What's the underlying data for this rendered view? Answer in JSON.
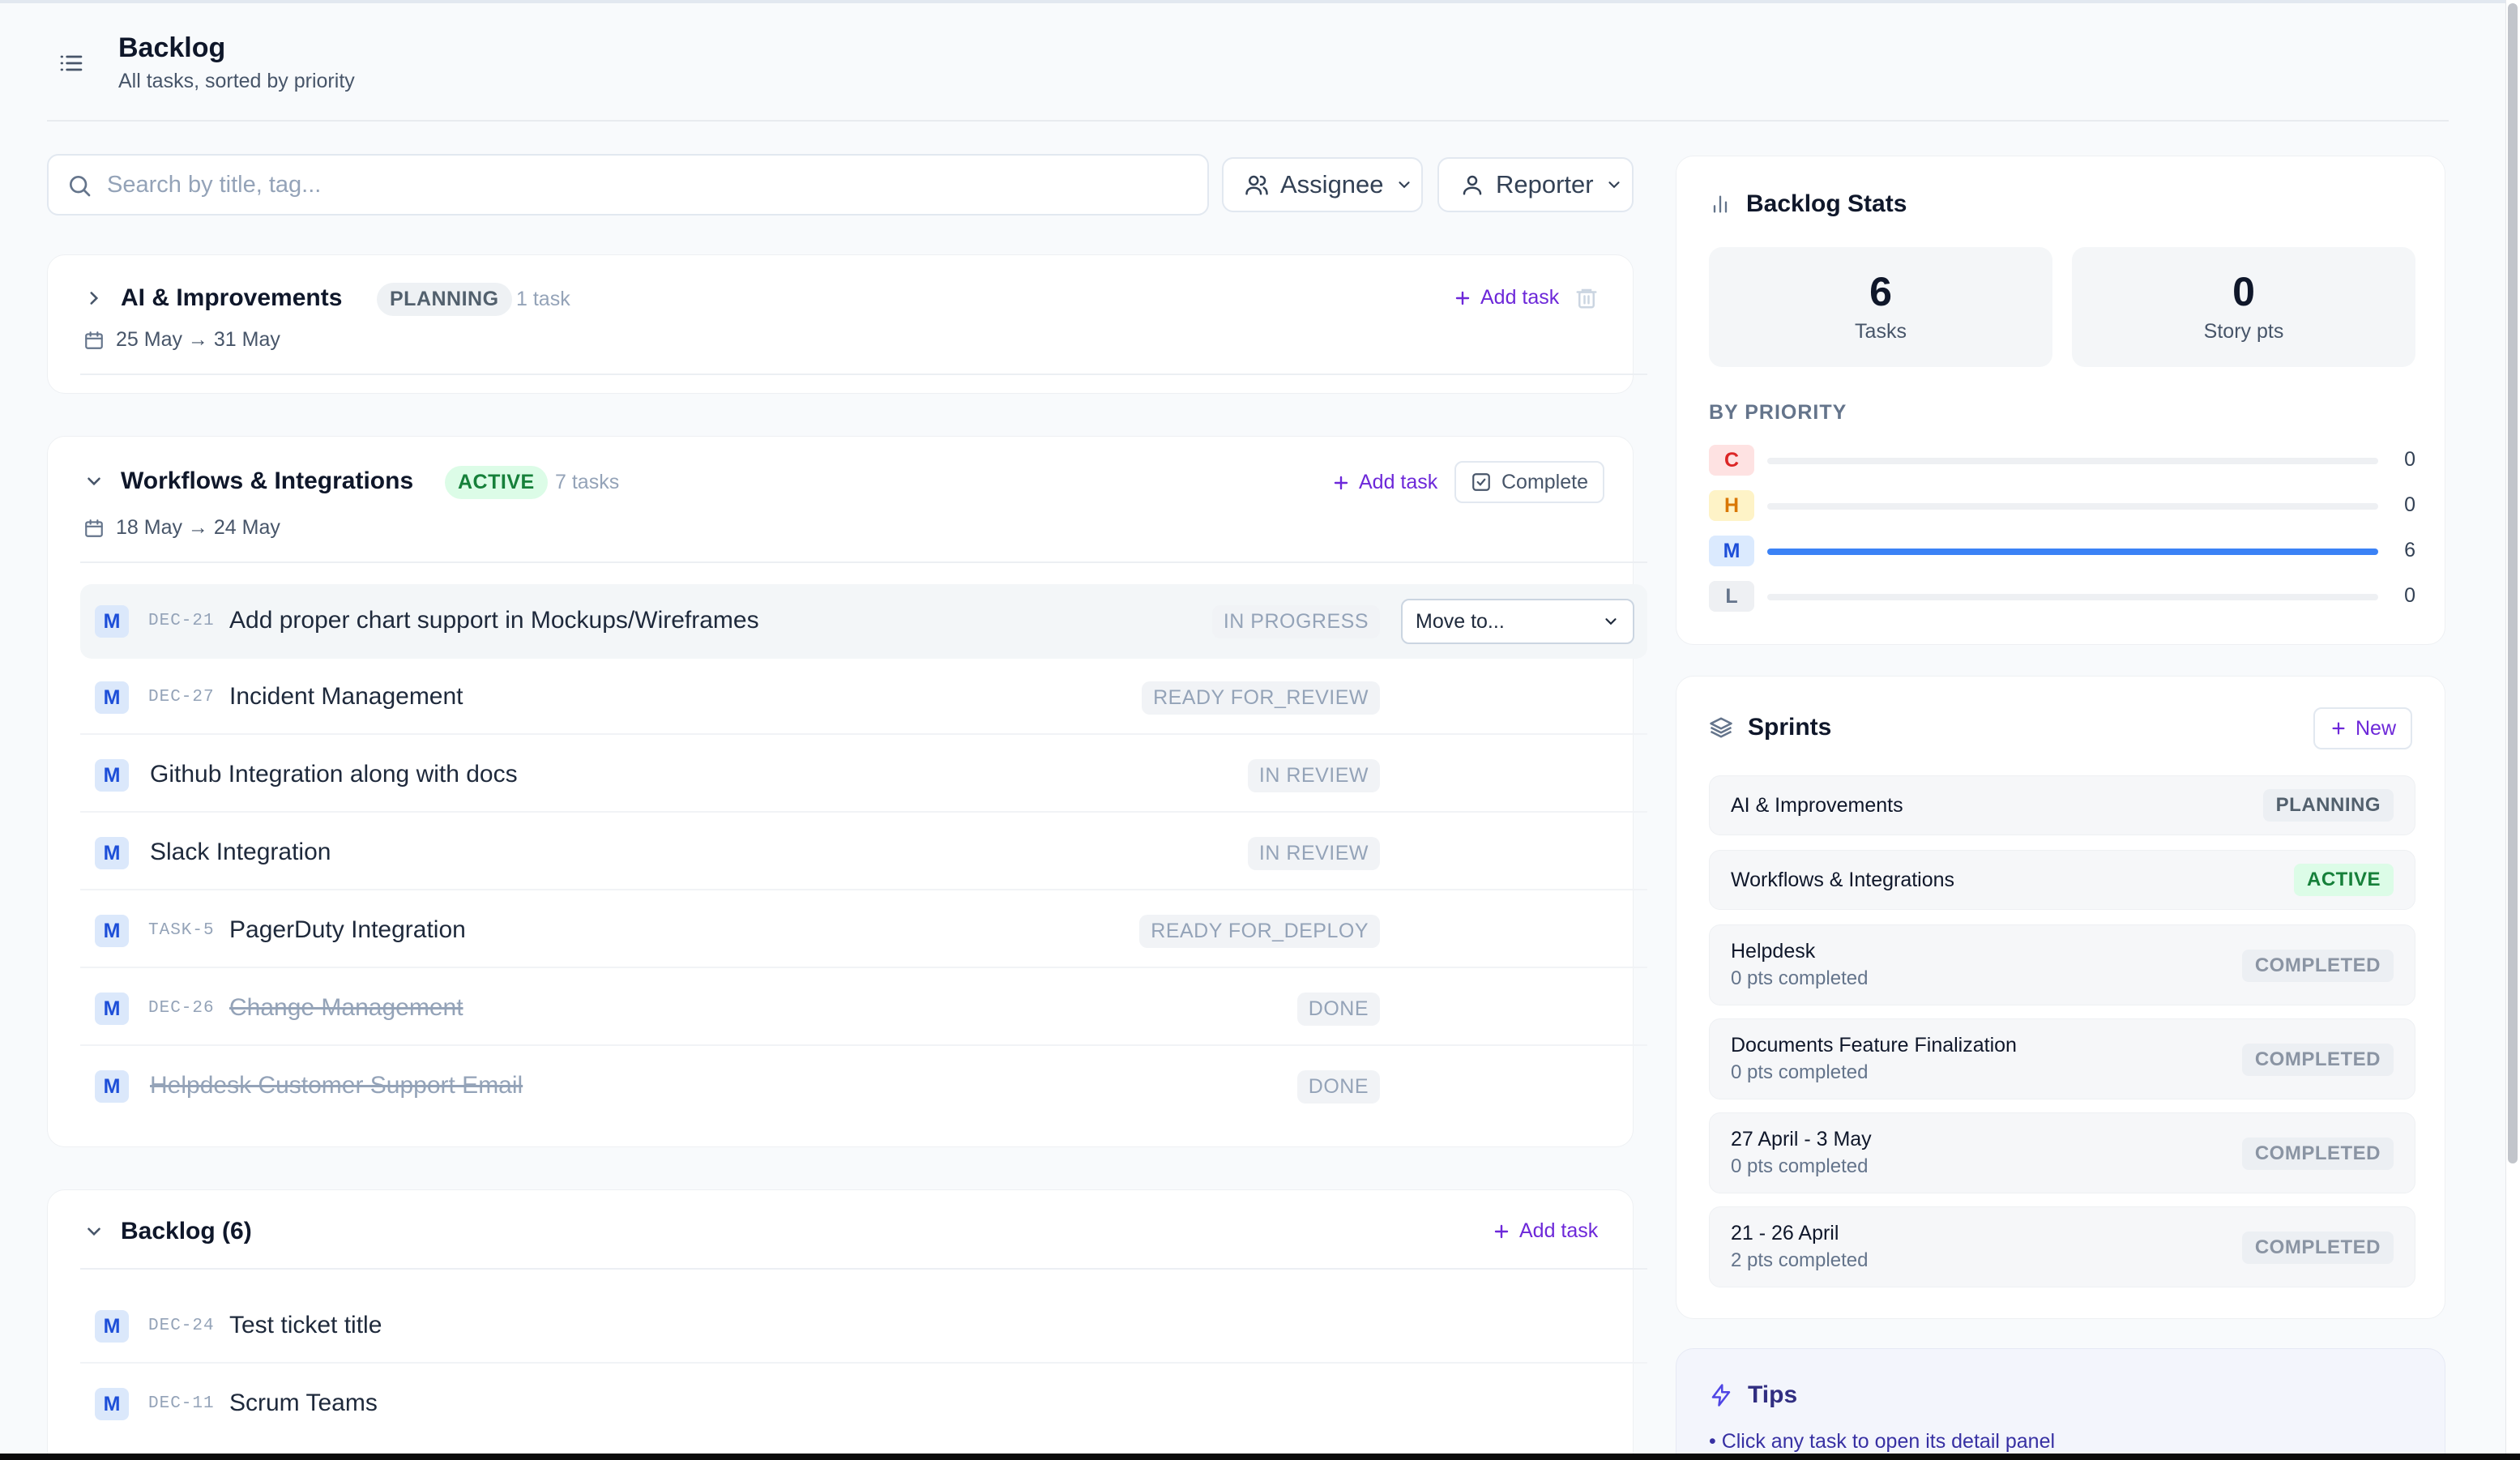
{
  "header": {
    "title": "Backlog",
    "subtitle": "All tasks, sorted by priority"
  },
  "search": {
    "placeholder": "Search by title, tag..."
  },
  "filters": {
    "assignee": "Assignee",
    "reporter": "Reporter"
  },
  "sprints_main": [
    {
      "name": "AI & Improvements",
      "status": "PLANNING",
      "task_count": "1 task",
      "dates": "25 May → 31 May",
      "add_task": "Add task",
      "expanded": false
    },
    {
      "name": "Workflows & Integrations",
      "status": "ACTIVE",
      "task_count": "7 tasks",
      "dates": "18 May → 24 May",
      "add_task": "Add task",
      "complete": "Complete",
      "expanded": true,
      "tasks": [
        {
          "priority": "M",
          "key": "DEC-21",
          "title": "Add proper chart support in Mockups/Wireframes",
          "status": "IN PROGRESS",
          "move_to": "Move to..."
        },
        {
          "priority": "M",
          "key": "DEC-27",
          "title": "Incident Management",
          "status": "READY FOR_REVIEW"
        },
        {
          "priority": "M",
          "key": "",
          "title": "Github Integration along with docs",
          "status": "IN REVIEW"
        },
        {
          "priority": "M",
          "key": "",
          "title": "Slack Integration",
          "status": "IN REVIEW"
        },
        {
          "priority": "M",
          "key": "TASK-5",
          "title": "PagerDuty Integration",
          "status": "READY FOR_DEPLOY"
        },
        {
          "priority": "M",
          "key": "DEC-26",
          "title": "Change Management",
          "status": "DONE"
        },
        {
          "priority": "M",
          "key": "",
          "title": "Helpdesk Customer Support Email",
          "status": "DONE"
        }
      ]
    }
  ],
  "backlog": {
    "title": "Backlog (6)",
    "add_task": "Add task",
    "tasks": [
      {
        "priority": "M",
        "key": "DEC-24",
        "title": "Test ticket title"
      },
      {
        "priority": "M",
        "key": "DEC-11",
        "title": "Scrum Teams"
      }
    ]
  },
  "stats": {
    "title": "Backlog Stats",
    "tasks_value": "6",
    "tasks_label": "Tasks",
    "points_value": "0",
    "points_label": "Story pts",
    "by_priority_label": "BY PRIORITY",
    "priorities": [
      {
        "label": "C",
        "count": 0,
        "count_text": "0",
        "fraction": 0,
        "chip_bg": "#fee2e2",
        "chip_fg": "#dc2626"
      },
      {
        "label": "H",
        "count": 0,
        "count_text": "0",
        "fraction": 0,
        "chip_bg": "#fef3c7",
        "chip_fg": "#d97706"
      },
      {
        "label": "M",
        "count": 6,
        "count_text": "6",
        "fraction": 1,
        "chip_bg": "#dbeafe",
        "chip_fg": "#1d4ed8"
      },
      {
        "label": "L",
        "count": 0,
        "count_text": "0",
        "fraction": 0,
        "chip_bg": "#eef0f3",
        "chip_fg": "#64748b"
      }
    ]
  },
  "sprints_panel": {
    "title": "Sprints",
    "new_label": "New",
    "items": [
      {
        "name": "AI & Improvements",
        "points": "",
        "status": "PLANNING"
      },
      {
        "name": "Workflows & Integrations",
        "points": "",
        "status": "ACTIVE"
      },
      {
        "name": "Helpdesk",
        "points": "0 pts completed",
        "status": "COMPLETED"
      },
      {
        "name": "Documents Feature Finalization",
        "points": "0 pts completed",
        "status": "COMPLETED"
      },
      {
        "name": "27 April - 3 May",
        "points": "0 pts completed",
        "status": "COMPLETED"
      },
      {
        "name": "21 - 26 April",
        "points": "2 pts completed",
        "status": "COMPLETED"
      }
    ]
  },
  "tips": {
    "title": "Tips",
    "line": "• Click any task to open its detail panel"
  },
  "colors": {
    "accent": "#6d28d9",
    "progress": "#3b82f6",
    "active_bg": "#dcfce7",
    "active_fg": "#16803a"
  }
}
